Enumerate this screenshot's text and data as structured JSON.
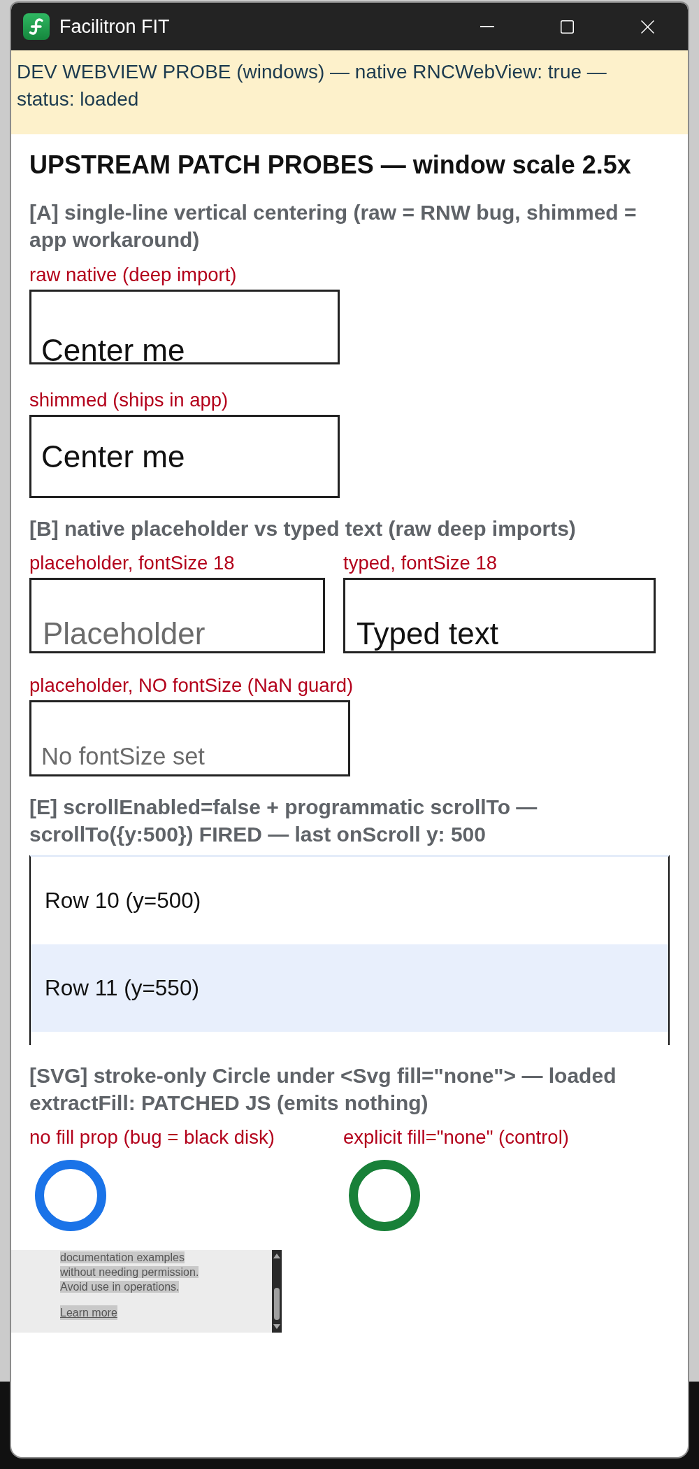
{
  "window": {
    "title": "Facilitron FIT"
  },
  "banner": {
    "text": "DEV WEBVIEW PROBE (windows) — native RNCWebView: true — status: loaded"
  },
  "heading": "UPSTREAM PATCH PROBES — window scale 2.5x",
  "section_a": {
    "title": "[A] single-line vertical centering (raw = RNW bug, shimmed = app workaround)",
    "inputs": [
      {
        "label": "raw native (deep import)",
        "kind": "raw",
        "value": "Center me"
      },
      {
        "label": "shimmed (ships in app)",
        "kind": "shimmed",
        "value": "Center me"
      }
    ]
  },
  "section_b": {
    "title": "[B] native placeholder vs typed text (raw deep imports)",
    "rows": [
      [
        {
          "label": "placeholder, fontSize 18",
          "kind": "sized",
          "placeholder": "Placeholder"
        },
        {
          "label": "typed, fontSize 18",
          "kind": "sized",
          "value": "Typed text"
        }
      ],
      [
        {
          "label": "placeholder, NO fontSize (NaN guard)",
          "kind": "unsized",
          "placeholder": "No fontSize set"
        }
      ]
    ]
  },
  "section_e": {
    "title": "[E] scrollEnabled=false + programmatic scrollTo — scrollTo({y:500}) FIRED — last onScroll y: 500",
    "rows": [
      {
        "label": "Row 10 (y=500)",
        "highlighted": false
      },
      {
        "label": "Row 11 (y=550)",
        "highlighted": true
      }
    ]
  },
  "section_svg": {
    "title": "[SVG] stroke-only Circle under <Svg fill=\"none\"> — loaded extractFill: PATCHED JS (emits nothing)",
    "circles": [
      {
        "label": "no fill prop (bug = black disk)",
        "color": "#1a73e8"
      },
      {
        "label": "explicit fill=\"none\" (control)",
        "color": "#188038"
      }
    ]
  },
  "info_panel": {
    "lines": [
      "documentation examples",
      "without needing permission.",
      "Avoid use in operations."
    ],
    "link": "Learn more"
  }
}
